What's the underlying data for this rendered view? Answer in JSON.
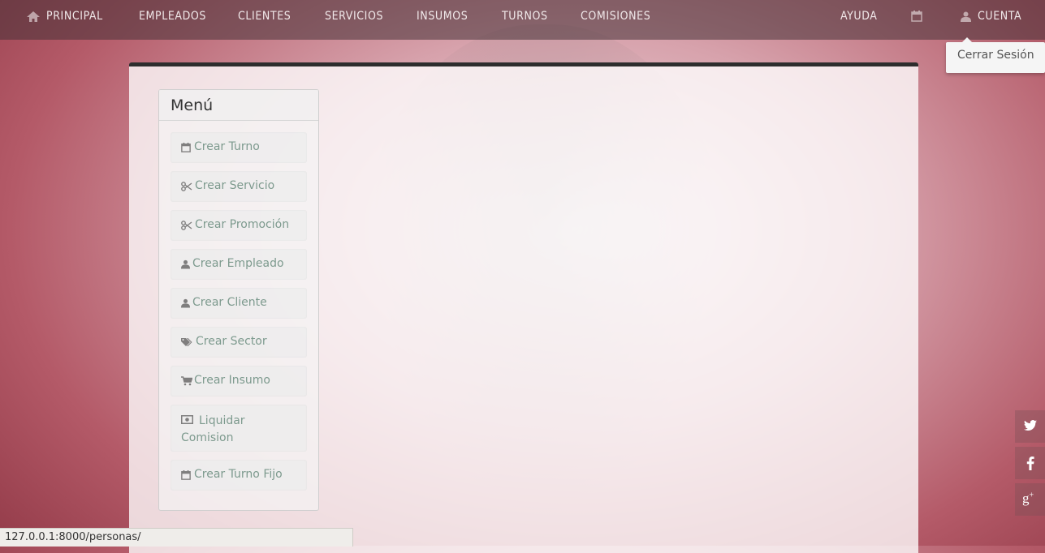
{
  "nav": {
    "principal": "PRINCIPAL",
    "empleados": "EMPLEADOS",
    "clientes": "CLIENTES",
    "servicios": "SERVICIOS",
    "insumos": "INSUMOS",
    "turnos": "TURNOS",
    "comisiones": "COMISIONES",
    "ayuda": "AYUDA",
    "cuenta": "CUENTA",
    "icons": {
      "principal": "home-icon",
      "calendar": "calendar-icon",
      "cuenta": "user-icon"
    }
  },
  "dropdown": {
    "logout": "Cerrar Sesión"
  },
  "menu": {
    "title": "Menú",
    "items": [
      {
        "label": "Crear Turno",
        "icon": "calendar-icon"
      },
      {
        "label": "Crear Servicio",
        "icon": "scissors-icon"
      },
      {
        "label": "Crear Promoción",
        "icon": "scissors-icon"
      },
      {
        "label": "Crear Empleado",
        "icon": "user-icon"
      },
      {
        "label": "Crear Cliente",
        "icon": "user-icon"
      },
      {
        "label": "Crear Sector",
        "icon": "tags-icon"
      },
      {
        "label": "Crear Insumo",
        "icon": "cart-icon"
      },
      {
        "label": "Liquidar Comision",
        "icon": "money-icon"
      },
      {
        "label": "Crear Turno Fijo",
        "icon": "calendar-icon"
      }
    ]
  },
  "status": {
    "url": "127.0.0.1:8000/personas/"
  },
  "social": {
    "twitter": "twitter-icon",
    "facebook": "facebook-icon",
    "googleplus": "google-plus-icon"
  }
}
